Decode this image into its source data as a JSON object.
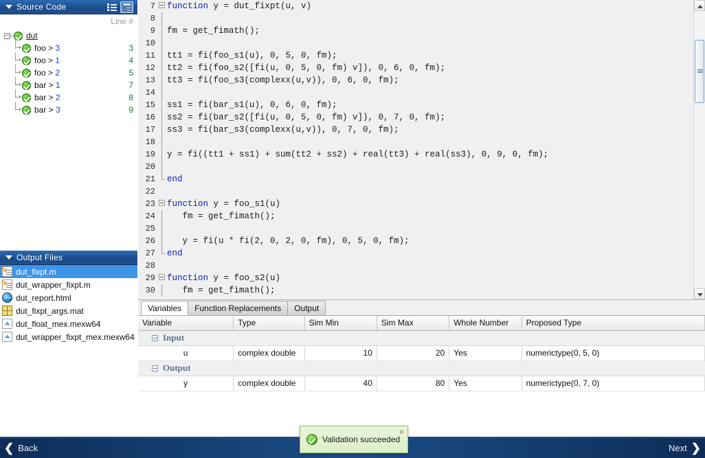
{
  "source_panel": {
    "title": "Source Code",
    "icons": {
      "list_view": "list-view-icon",
      "tree_view": "tree-view-icon"
    },
    "line_header": "Line #",
    "root": {
      "label": "dut",
      "status": "ok"
    },
    "nodes": [
      {
        "name": "foo",
        "sep": " > ",
        "index": "3",
        "line": "3",
        "status": "ok"
      },
      {
        "name": "foo",
        "sep": " > ",
        "index": "1",
        "line": "4",
        "status": "ok"
      },
      {
        "name": "foo",
        "sep": " > ",
        "index": "2",
        "line": "5",
        "status": "ok"
      },
      {
        "name": "bar",
        "sep": " > ",
        "index": "1",
        "line": "7",
        "status": "ok"
      },
      {
        "name": "bar",
        "sep": " > ",
        "index": "2",
        "line": "8",
        "status": "ok"
      },
      {
        "name": "bar",
        "sep": " > ",
        "index": "3",
        "line": "9",
        "status": "ok"
      }
    ]
  },
  "output_panel": {
    "title": "Output Files",
    "files": [
      {
        "name": "dut_fixpt.m",
        "icon": "matlab-function-file-icon",
        "selected": true
      },
      {
        "name": "dut_wrapper_fixpt.m",
        "icon": "matlab-function-file-icon",
        "selected": false
      },
      {
        "name": "dut_report.html",
        "icon": "html-globe-icon",
        "selected": false
      },
      {
        "name": "dut_fixpt_args.mat",
        "icon": "mat-grid-icon",
        "selected": false
      },
      {
        "name": "dut_float_mex.mexw64",
        "icon": "mex-file-icon",
        "selected": false
      },
      {
        "name": "dut_wrapper_fixpt_mex.mexw64",
        "icon": "mex-file-icon",
        "selected": false
      }
    ]
  },
  "editor": {
    "lines": [
      {
        "n": "7",
        "fold": "start",
        "text": "function y = dut_fixpt(u, v)",
        "kw": "function"
      },
      {
        "n": "8",
        "fold": "bar",
        "text": ""
      },
      {
        "n": "9",
        "fold": "bar",
        "text": "fm = get_fimath();"
      },
      {
        "n": "10",
        "fold": "bar",
        "text": ""
      },
      {
        "n": "11",
        "fold": "bar",
        "text": "tt1 = fi(foo_s1(u), 0, 5, 0, fm);"
      },
      {
        "n": "12",
        "fold": "bar",
        "text": "tt2 = fi(foo_s2([fi(u, 0, 5, 0, fm) v]), 0, 6, 0, fm);"
      },
      {
        "n": "13",
        "fold": "bar",
        "text": "tt3 = fi(foo_s3(complexx(u,v)), 0, 6, 0, fm);"
      },
      {
        "n": "14",
        "fold": "bar",
        "text": ""
      },
      {
        "n": "15",
        "fold": "bar",
        "text": "ss1 = fi(bar_s1(u), 0, 6, 0, fm);"
      },
      {
        "n": "16",
        "fold": "bar",
        "text": "ss2 = fi(bar_s2([fi(u, 0, 5, 0, fm) v]), 0, 7, 0, fm);"
      },
      {
        "n": "17",
        "fold": "bar",
        "text": "ss3 = fi(bar_s3(complexx(u,v)), 0, 7, 0, fm);"
      },
      {
        "n": "18",
        "fold": "bar",
        "text": ""
      },
      {
        "n": "19",
        "fold": "bar",
        "text": "y = fi((tt1 + ss1) + sum(tt2 + ss2) + real(tt3) + real(ss3), 0, 9, 0, fm);"
      },
      {
        "n": "20",
        "fold": "bar",
        "text": ""
      },
      {
        "n": "21",
        "fold": "end",
        "text": "end",
        "kw": "end"
      },
      {
        "n": "22",
        "fold": "none",
        "text": ""
      },
      {
        "n": "23",
        "fold": "start",
        "text": "function y = foo_s1(u)",
        "kw": "function"
      },
      {
        "n": "24",
        "fold": "bar",
        "text": "   fm = get_fimath();"
      },
      {
        "n": "25",
        "fold": "bar",
        "text": ""
      },
      {
        "n": "26",
        "fold": "bar",
        "text": "   y = fi(u * fi(2, 0, 2, 0, fm), 0, 5, 0, fm);"
      },
      {
        "n": "27",
        "fold": "end",
        "text": "end",
        "kw": "end"
      },
      {
        "n": "28",
        "fold": "none",
        "text": ""
      },
      {
        "n": "29",
        "fold": "start",
        "text": "function y = foo_s2(u)",
        "kw": "function"
      },
      {
        "n": "30",
        "fold": "bar",
        "text": "   fm = get_fimath();"
      }
    ]
  },
  "bottom": {
    "tabs": [
      {
        "label": "Variables",
        "active": true
      },
      {
        "label": "Function Replacements",
        "active": false
      },
      {
        "label": "Output",
        "active": false
      }
    ],
    "columns": [
      "Variable",
      "Type",
      "Sim Min",
      "Sim Max",
      "Whole Number",
      "Proposed Type"
    ],
    "groups": [
      {
        "label": "Input",
        "rows": [
          {
            "variable": "u",
            "type": "complex double",
            "sim_min": "10",
            "sim_max": "20",
            "whole_number": "Yes",
            "proposed_type": "numerictype(0, 5, 0)"
          }
        ]
      },
      {
        "label": "Output",
        "rows": [
          {
            "variable": "y",
            "type": "complex double",
            "sim_min": "40",
            "sim_max": "80",
            "whole_number": "Yes",
            "proposed_type": "numerictype(0, 7, 0)"
          }
        ]
      }
    ]
  },
  "notification": {
    "message": "Validation succeeded",
    "icon": "success-check-icon",
    "close": "×"
  },
  "navbar": {
    "back_label": "Back",
    "next_label": "Next",
    "back_chevron": "❮",
    "next_chevron": "❯"
  },
  "colors": {
    "header_blue": "#1f5496",
    "selection_blue": "#3d94e8",
    "success_green": "#4cb91e",
    "keyword_blue": "#0b23b3",
    "line_number_green": "#157a43",
    "navbar_blue": "#1b4d86"
  }
}
